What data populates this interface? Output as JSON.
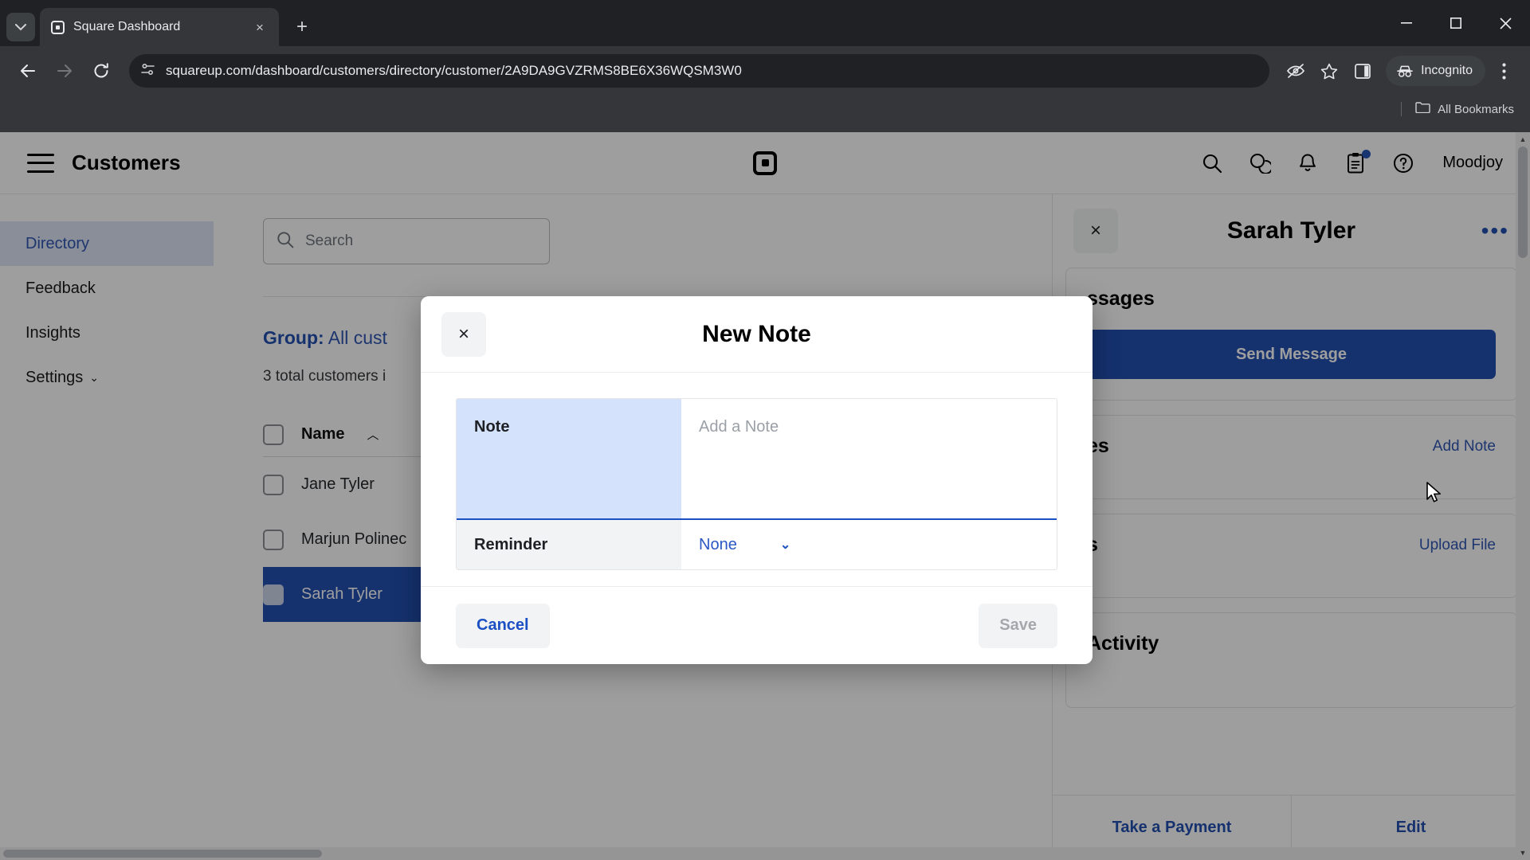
{
  "browser": {
    "tab": {
      "title": "Square Dashboard",
      "favicon": "square-logo-icon",
      "close": "×"
    },
    "tab_search_icon": "chevron-down-icon",
    "new_tab_icon": "+",
    "window": {
      "minimize": "—",
      "maximize": "□",
      "close": "✕"
    },
    "nav": {
      "back": "←",
      "forward": "→",
      "reload": "⟳"
    },
    "omnibox": {
      "site_settings_icon": "page-settings-icon",
      "url": "squareup.com/dashboard/customers/directory/customer/2A9DA9GVZRMS8BE6X36WQSM3W0"
    },
    "toolbar_icons": [
      "eye-slash-icon",
      "star-icon",
      "side-panel-icon"
    ],
    "incognito_label": "Incognito",
    "menu_icon": "kebab-menu-icon",
    "bookmarks": {
      "label": "All Bookmarks",
      "folder_icon": "folder-icon"
    }
  },
  "appbar": {
    "menu_icon": "hamburger-icon",
    "title": "Customers",
    "logo": "square-logo-icon",
    "icons": [
      "search-icon",
      "messages-icon",
      "bell-icon",
      "clipboard-icon",
      "help-icon"
    ],
    "account": "Moodjoy"
  },
  "sidebar": {
    "items": [
      {
        "label": "Directory",
        "active": true
      },
      {
        "label": "Feedback",
        "active": false
      },
      {
        "label": "Insights",
        "active": false
      },
      {
        "label": "Settings",
        "active": false,
        "chevron": "⌄"
      }
    ]
  },
  "directory": {
    "search": {
      "placeholder": "Search",
      "value": "",
      "icon": "search-icon"
    },
    "group_label": "Group:",
    "group_value": "All cust",
    "total_text": "3 total customers i",
    "table": {
      "header": {
        "name": "Name",
        "sort_caret": "︿"
      },
      "rows": [
        {
          "name": "Jane Tyler",
          "selected": false
        },
        {
          "name": "Marjun Polinec",
          "selected": false
        },
        {
          "name": "Sarah Tyler",
          "selected": true
        }
      ]
    }
  },
  "detail_panel": {
    "close_icon": "×",
    "title": "Sarah Tyler",
    "more_icon": "•••",
    "messages": {
      "title": "ssages",
      "send_label": "Send Message"
    },
    "notes": {
      "title": "es",
      "link": "Add Note"
    },
    "files": {
      "title": "s",
      "link": "Upload File"
    },
    "activity": {
      "title": "Activity"
    },
    "footer": {
      "payment": "Take a Payment",
      "edit": "Edit"
    }
  },
  "modal": {
    "close_icon": "×",
    "title": "New Note",
    "fields": {
      "note": {
        "label": "Note",
        "placeholder": "Add a Note",
        "value": ""
      },
      "reminder": {
        "label": "Reminder",
        "value": "None",
        "chevron": "⌄"
      }
    },
    "cancel_label": "Cancel",
    "save_label": "Save"
  },
  "colors": {
    "accent_blue": "#1b50c4",
    "link_blue": "#2a57c4",
    "focus_fill": "#d4e2fb",
    "chrome_dark": "#35363a"
  }
}
